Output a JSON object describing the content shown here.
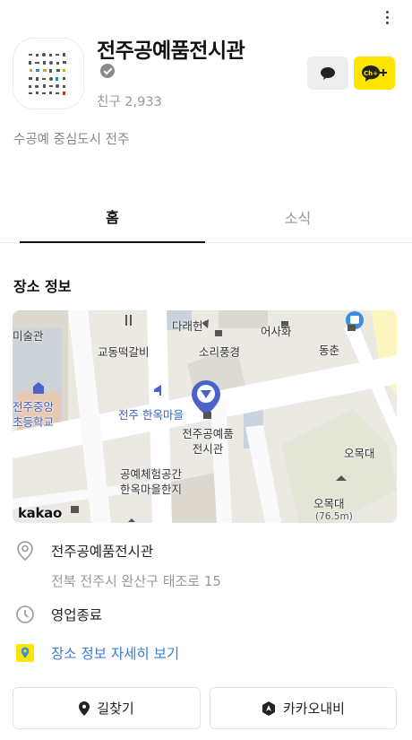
{
  "header": {
    "more_icon": "more-vertical-icon"
  },
  "profile": {
    "channel_name": "전주공예품전시관",
    "verified_icon": "verified-badge-icon",
    "friends_label": "친구",
    "friends_count": "2,933",
    "description": "수공예 중심도시 전주",
    "chat_icon": "chat-bubble-icon",
    "add_channel_label": "Ch+",
    "accent_color": "#fee500"
  },
  "tabs": [
    {
      "label": "홈",
      "active": true
    },
    {
      "label": "소식",
      "active": false
    }
  ],
  "place": {
    "section_title": "장소 정보",
    "map": {
      "labels": {
        "art_museum": "미술관",
        "darahyeon": "다래헌",
        "eosahwa": "어사화",
        "gyodong_tteokgalbi": "교동떡갈비",
        "sori_punggyeong": "소리풍경",
        "dongchun": "동춘",
        "hanok_village": "전주 한옥마을",
        "school_line1": "전주중앙",
        "school_line2": "초등학교",
        "pin_line1": "전주공예품",
        "pin_line2": "전시관",
        "omokdae_top": "오목대",
        "craft_line1": "공예체험공간",
        "craft_line2": "한옥마을한지",
        "omokdae_peak": "오목대",
        "elevation": "(76.5m)",
        "logo": "kakao"
      }
    },
    "name": "전주공예품전시관",
    "address": "전북 전주시 완산구 태조로 15",
    "status": "영업종료",
    "detail_link": "장소 정보 자세히 보기"
  },
  "actions": {
    "route_label": "길찾기",
    "navi_label": "카카오내비"
  }
}
